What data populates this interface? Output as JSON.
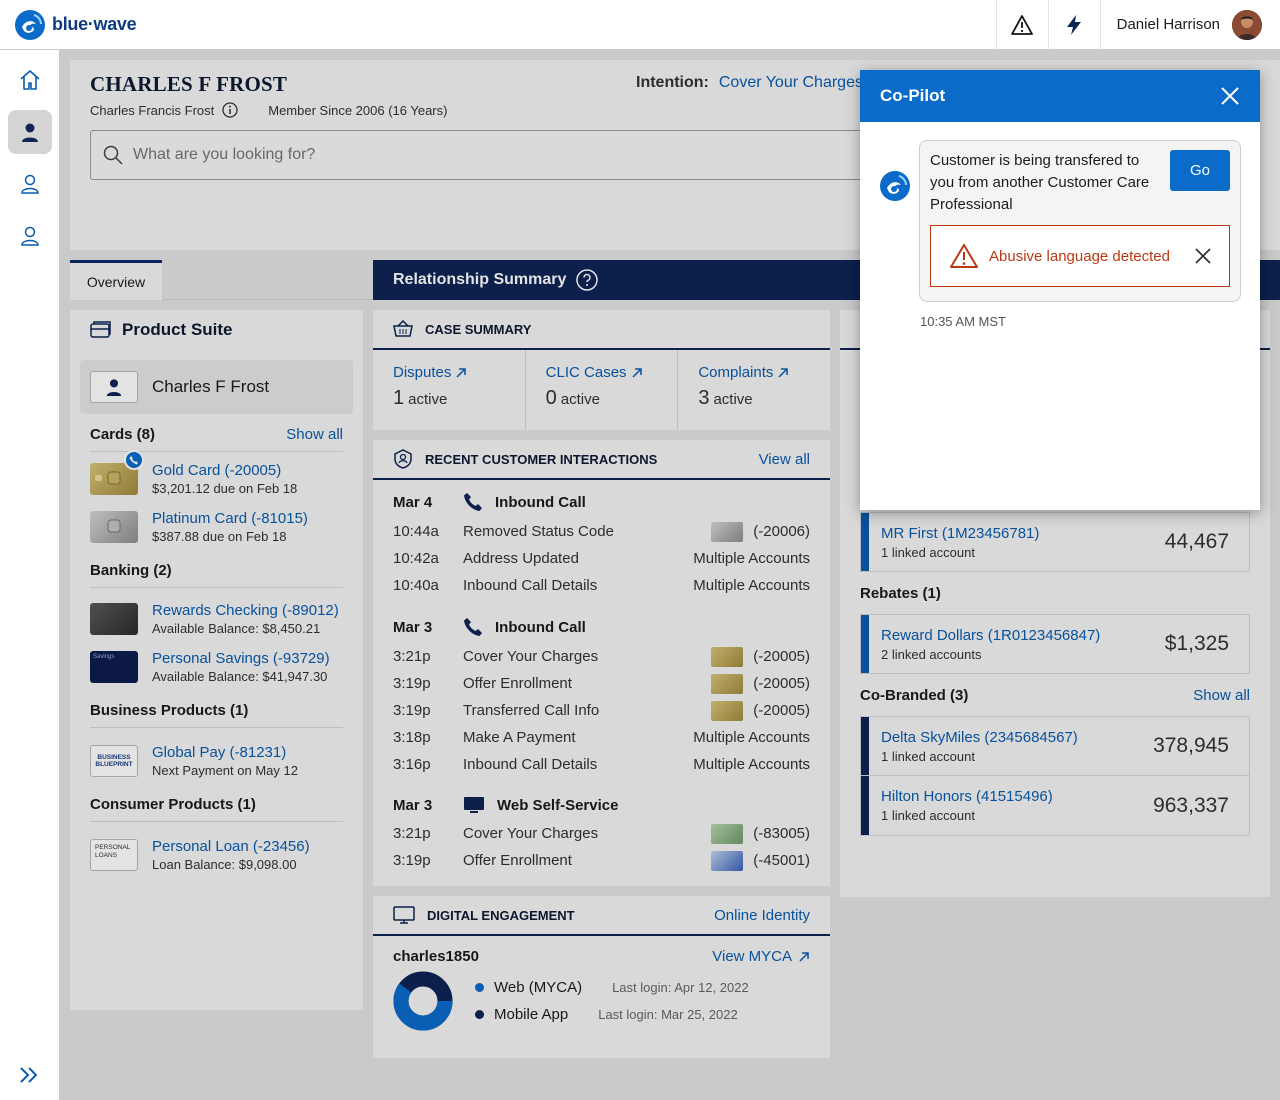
{
  "app": {
    "logo_text": "blue·wave"
  },
  "topbar": {
    "user_name": "Daniel Harrison"
  },
  "header": {
    "customer_name": "CHARLES F FROST",
    "full_name": "Charles Francis Frost",
    "member_since": "Member Since 2006 (16 Years)",
    "intention_label": "Intention:",
    "intention_value": "Cover Your Charges",
    "search_placeholder": "What are you looking for?"
  },
  "tabs": [
    {
      "label": "Overview"
    }
  ],
  "product_suite": {
    "title": "Product Suite",
    "person": "Charles F Frost",
    "sections": [
      {
        "title": "Cards (8)",
        "link": "Show all",
        "items": [
          {
            "name": "Gold Card (-20005)",
            "sub": "$3,201.12 due on Feb 18"
          },
          {
            "name": "Platinum Card (-81015)",
            "sub": "$387.88 due on Feb 18"
          }
        ]
      },
      {
        "title": "Banking (2)",
        "link": "",
        "items": [
          {
            "name": "Rewards Checking (-89012)",
            "sub": "Available Balance: $8,450.21"
          },
          {
            "name": "Personal Savings (-93729)",
            "sub": "Available Balance: $41,947.30"
          }
        ]
      },
      {
        "title": "Business Products (1)",
        "link": "",
        "items": [
          {
            "name": "Global Pay (-81231)",
            "sub": "Next Payment on May 12"
          }
        ]
      },
      {
        "title": "Consumer Products (1)",
        "link": "",
        "items": [
          {
            "name": "Personal Loan (-23456)",
            "sub": "Loan Balance: $9,098.00"
          }
        ]
      }
    ],
    "thumb_text": {
      "savings": "Savings",
      "business": "BUSINESS BLUEPRINT",
      "loan": "PERSONAL LOANS"
    }
  },
  "relationship": {
    "title": "Relationship Summary"
  },
  "case_summary": {
    "title": "CASE SUMMARY",
    "cells": [
      {
        "label": "Disputes",
        "count": "1",
        "unit": "active"
      },
      {
        "label": "CLIC Cases",
        "count": "0",
        "unit": "active"
      },
      {
        "label": "Complaints",
        "count": "3",
        "unit": "active"
      }
    ]
  },
  "interactions": {
    "title": "RECENT CUSTOMER INTERACTIONS",
    "link": "View all",
    "groups": [
      {
        "date": "Mar 4",
        "channel": "Inbound Call",
        "rows": [
          {
            "time": "10:44a",
            "action": "Removed Status Code",
            "account": "(-20006)"
          },
          {
            "time": "10:42a",
            "action": "Address Updated",
            "account": "Multiple Accounts"
          },
          {
            "time": "10:40a",
            "action": "Inbound Call Details",
            "account": "Multiple Accounts"
          }
        ]
      },
      {
        "date": "Mar 3",
        "channel": "Inbound Call",
        "rows": [
          {
            "time": "3:21p",
            "action": "Cover Your Charges",
            "account": "(-20005)"
          },
          {
            "time": "3:19p",
            "action": "Offer Enrollment",
            "account": "(-20005)"
          },
          {
            "time": "3:19p",
            "action": "Transferred Call Info",
            "account": "(-20005)"
          },
          {
            "time": "3:18p",
            "action": "Make A Payment",
            "account": "Multiple Accounts"
          },
          {
            "time": "3:16p",
            "action": "Inbound Call Details",
            "account": "Multiple Accounts"
          }
        ]
      },
      {
        "date": "Mar 3",
        "channel": "Web Self-Service",
        "rows": [
          {
            "time": "3:21p",
            "action": "Cover Your Charges",
            "account": "(-83005)"
          },
          {
            "time": "3:19p",
            "action": "Offer Enrollment",
            "account": "(-45001)"
          }
        ]
      }
    ]
  },
  "digital": {
    "title": "DIGITAL ENGAGEMENT",
    "link": "Online Identity",
    "username": "charles1850",
    "view_link": "View MYCA",
    "channels": [
      {
        "name": "Web (MYCA)",
        "login": "Last login: Apr 12, 2022",
        "color": "#0a6bc9"
      },
      {
        "name": "Mobile App",
        "login": "Last login: Mar 25, 2022",
        "color": "#0e2555"
      }
    ],
    "web_share": 0.6
  },
  "rewards": {
    "items_a": [
      {
        "name": "MR First (1M23456781)",
        "sub": "1 linked account",
        "value": "44,467"
      }
    ],
    "rebates_title": "Rebates (1)",
    "items_b": [
      {
        "name": "Reward Dollars (1R0123456847)",
        "sub": "2 linked accounts",
        "value": "$1,325"
      }
    ],
    "cobranded_title": "Co-Branded (3)",
    "cobranded_link": "Show all",
    "items_c": [
      {
        "name": "Delta SkyMiles (2345684567)",
        "sub": "1 linked account",
        "value": "378,945"
      },
      {
        "name": "Hilton Honors (41515496)",
        "sub": "1 linked account",
        "value": "963,337"
      }
    ]
  },
  "copilot": {
    "title": "Co-Pilot",
    "message": "Customer is being transfered to you from another Customer Care Professional",
    "go_label": "Go",
    "alert": "Abusive language detected",
    "timestamp": "10:35 AM MST"
  },
  "colors": {
    "navy": "#0e2555",
    "link": "#0a5cb0",
    "copilot_blue": "#0a6bc9",
    "alert": "#b93a12"
  }
}
